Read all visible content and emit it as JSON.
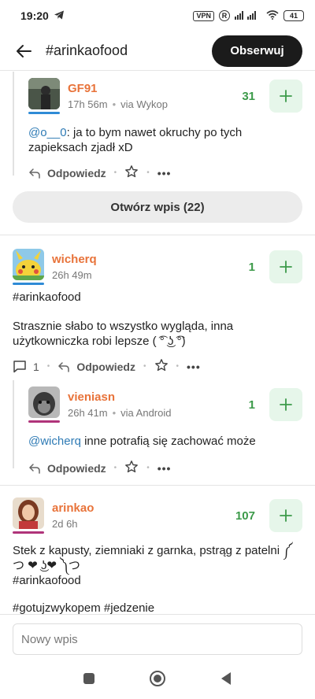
{
  "status": {
    "time": "19:20",
    "vpn": "VPN",
    "r": "R",
    "battery": "41"
  },
  "header": {
    "title": "#arinkaofood",
    "follow_label": "Obserwuj"
  },
  "comment1": {
    "user": "GF91",
    "time": "17h 56m",
    "via": "via Wykop",
    "votes": "31",
    "mention": "@o__0",
    "text": ": ja to bym nawet okruchy po tych zapieksach zjadł xD",
    "reply_label": "Odpowiedz"
  },
  "open_entry_label": "Otwórz wpis (22)",
  "post1": {
    "user": "wicherq",
    "time": "26h 49m",
    "votes": "1",
    "tag": "#arinkaofood",
    "text": "Strasznie słabo to wszystko wygląda, inna użytkowniczka robi lepsze ( ͡° ͜ʖ ͡°)",
    "comments_count": "1",
    "reply_label": "Odpowiedz"
  },
  "comment2": {
    "user": "vieniasn",
    "time": "26h 41m",
    "via": "via Android",
    "votes": "1",
    "mention": "@wicherq",
    "text": " inne potrafią się zachować może",
    "reply_label": "Odpowiedz"
  },
  "post2": {
    "user": "arinkao",
    "time": "2d 6h",
    "votes": "107",
    "text": "Stek z kapusty, ziemniaki z garnka, pstrąg z patelni ༼ つ ❤ ͜ʖ❤ ༽つ",
    "tag": "#arinkaofood",
    "tags2": "#gotujzwykopem #jedzenie"
  },
  "composer": {
    "placeholder": "Nowy wpis"
  },
  "colors": {
    "accent_orange": "#e8733a",
    "vote_green": "#3c9a4a",
    "tag_blue": "#2f7bb5",
    "follow_bg": "#1b1b1b"
  }
}
